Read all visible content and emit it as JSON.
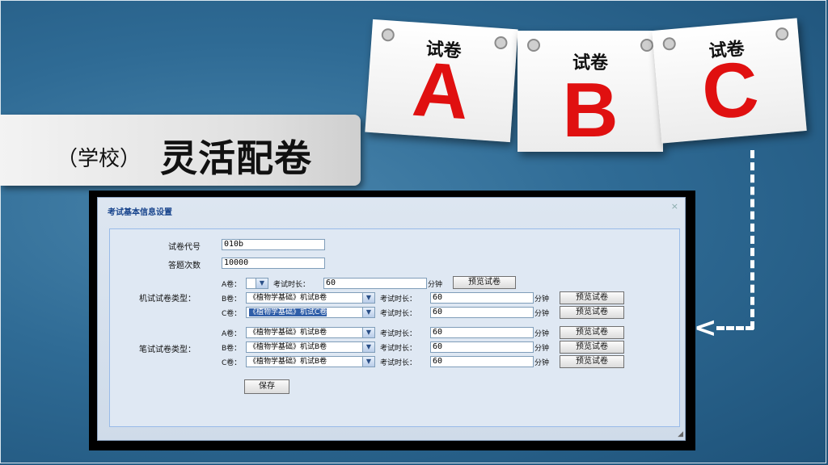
{
  "slide": {
    "subtitle": "（学校）",
    "title": "灵活配卷",
    "cards": [
      {
        "label": "试卷",
        "letter": "A"
      },
      {
        "label": "试卷",
        "letter": "B"
      },
      {
        "label": "试卷",
        "letter": "C"
      }
    ],
    "colors": {
      "accent_red": "#e01010",
      "background": "#2f6b95"
    }
  },
  "dialog": {
    "title": "考试基本信息设置",
    "close": "×",
    "fields": {
      "paper_code_label": "试卷代号",
      "paper_code_value": "010b",
      "attempts_label": "答题次数",
      "attempts_value": "10000"
    },
    "machine_section_label": "机试试卷类型：",
    "written_section_label": "笔试试卷类型：",
    "exam_time_label": "考试时长：",
    "minutes_unit": "分钟",
    "preview_button": "预览试卷",
    "machine_rows": [
      {
        "prefix": "A卷：",
        "paper": "",
        "time": "60"
      },
      {
        "prefix": "B卷：",
        "paper": "《植物学基础》机试B卷",
        "time": "60"
      },
      {
        "prefix": "C卷：",
        "paper": "《植物学基础》机试C卷",
        "time": "60"
      }
    ],
    "written_rows": [
      {
        "prefix": "A卷：",
        "paper": "《植物学基础》机试B卷",
        "time": "60"
      },
      {
        "prefix": "B卷：",
        "paper": "《植物学基础》机试B卷",
        "time": "60"
      },
      {
        "prefix": "C卷：",
        "paper": "《植物学基础》机试B卷",
        "time": "60"
      }
    ],
    "save_button": "保存"
  }
}
